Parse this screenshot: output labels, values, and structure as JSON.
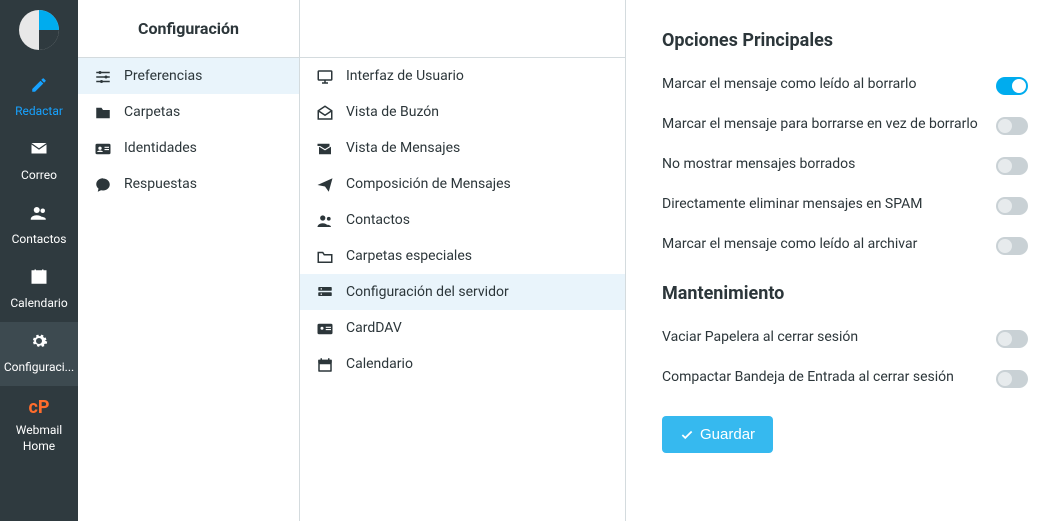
{
  "header": {
    "title": "Configuración"
  },
  "nav": {
    "compose": "Redactar",
    "mail": "Correo",
    "contacts": "Contactos",
    "calendar": "Calendario",
    "settings": "Configuraci...",
    "webmail_home": "Webmail Home"
  },
  "settings": {
    "preferences": "Preferencias",
    "folders": "Carpetas",
    "identities": "Identidades",
    "responses": "Respuestas"
  },
  "sections": {
    "ui": "Interfaz de Usuario",
    "mailbox_view": "Vista de Buzón",
    "messages_view": "Vista de Mensajes",
    "compose": "Composición de Mensajes",
    "contacts": "Contactos",
    "special_folders": "Carpetas especiales",
    "server_config": "Configuración del servidor",
    "carddav": "CardDAV",
    "calendar": "Calendario"
  },
  "content": {
    "main_title": "Opciones Principales",
    "opt_read_on_delete": "Marcar el mensaje como leído al borrarlo",
    "opt_flag_instead_delete": "Marcar el mensaje para borrarse en vez de borrarlo",
    "opt_hide_deleted": "No mostrar mensajes borrados",
    "opt_delete_spam_direct": "Directamente eliminar mensajes en SPAM",
    "opt_read_on_archive": "Marcar el mensaje como leído al archivar",
    "maint_title": "Mantenimiento",
    "opt_empty_trash": "Vaciar Papelera al cerrar sesión",
    "opt_compact_inbox": "Compactar Bandeja de Entrada al cerrar sesión",
    "save": "Guardar"
  },
  "state": {
    "opt_read_on_delete": true,
    "opt_flag_instead_delete": false,
    "opt_hide_deleted": false,
    "opt_delete_spam_direct": false,
    "opt_read_on_archive": false,
    "opt_empty_trash": false,
    "opt_compact_inbox": false
  }
}
